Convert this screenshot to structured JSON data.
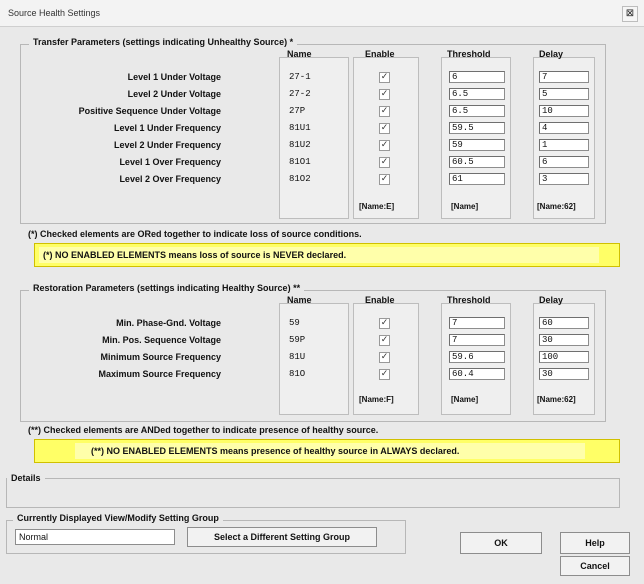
{
  "window": {
    "title": "Source Health Settings",
    "close_glyph": "⊠",
    "close_icon": "close-icon"
  },
  "transfer": {
    "legend": "Transfer Parameters (settings indicating Unhealthy Source) *",
    "headers": {
      "name": "Name",
      "enable": "Enable",
      "threshold": "Threshold",
      "delay": "Delay"
    },
    "rows": [
      {
        "label": "Level 1 Under Voltage",
        "name": "27-1",
        "enabled": true,
        "threshold": "6",
        "delay": "7"
      },
      {
        "label": "Level 2 Under Voltage",
        "name": "27-2",
        "enabled": true,
        "threshold": "6.5",
        "delay": "5"
      },
      {
        "label": "Positive Sequence Under Voltage",
        "name": "27P",
        "enabled": true,
        "threshold": "6.5",
        "delay": "10"
      },
      {
        "label": "Level 1 Under Frequency",
        "name": "81U1",
        "enabled": true,
        "threshold": "59.5",
        "delay": "4"
      },
      {
        "label": "Level 2 Under Frequency",
        "name": "81U2",
        "enabled": true,
        "threshold": "59",
        "delay": "1"
      },
      {
        "label": "Level 1 Over Frequency",
        "name": "81O1",
        "enabled": true,
        "threshold": "60.5",
        "delay": "6"
      },
      {
        "label": "Level 2 Over Frequency",
        "name": "81O2",
        "enabled": true,
        "threshold": "61",
        "delay": "3"
      }
    ],
    "footers": {
      "enable": "[Name:E]",
      "threshold": "[Name]",
      "delay": "[Name:62]"
    }
  },
  "transfer_note": "(*) Checked elements are ORed together to indicate loss of source conditions.",
  "transfer_warning": "(*) NO ENABLED ELEMENTS means loss of source is NEVER declared.",
  "restoration": {
    "legend": "Restoration Parameters (settings indicating Healthy Source) **",
    "headers": {
      "name": "Name",
      "enable": "Enable",
      "threshold": "Threshold",
      "delay": "Delay"
    },
    "rows": [
      {
        "label": "Min. Phase-Gnd. Voltage",
        "name": "59",
        "enabled": true,
        "threshold": "7",
        "delay": "60"
      },
      {
        "label": "Min. Pos. Sequence Voltage",
        "name": "59P",
        "enabled": true,
        "threshold": "7",
        "delay": "30"
      },
      {
        "label": "Minimum Source Frequency",
        "name": "81U",
        "enabled": true,
        "threshold": "59.6",
        "delay": "100"
      },
      {
        "label": "Maximum Source Frequency",
        "name": "81O",
        "enabled": true,
        "threshold": "60.4",
        "delay": "30"
      }
    ],
    "footers": {
      "enable": "[Name:F]",
      "threshold": "[Name]",
      "delay": "[Name:62]"
    }
  },
  "restoration_note": "(**) Checked elements are ANDed together to indicate presence of healthy source.",
  "restoration_warning": "(**) NO ENABLED ELEMENTS means presence of healthy source in ALWAYS declared.",
  "details": {
    "legend": "Details"
  },
  "setting_group": {
    "legend": "Currently Displayed View/Modify Setting Group",
    "value": "Normal",
    "select_button": "Select a Different Setting Group"
  },
  "buttons": {
    "ok": "OK",
    "help": "Help",
    "cancel": "Cancel"
  },
  "colors": {
    "warning_bg": "#ffff66",
    "window_bg": "#e9e9e9"
  }
}
